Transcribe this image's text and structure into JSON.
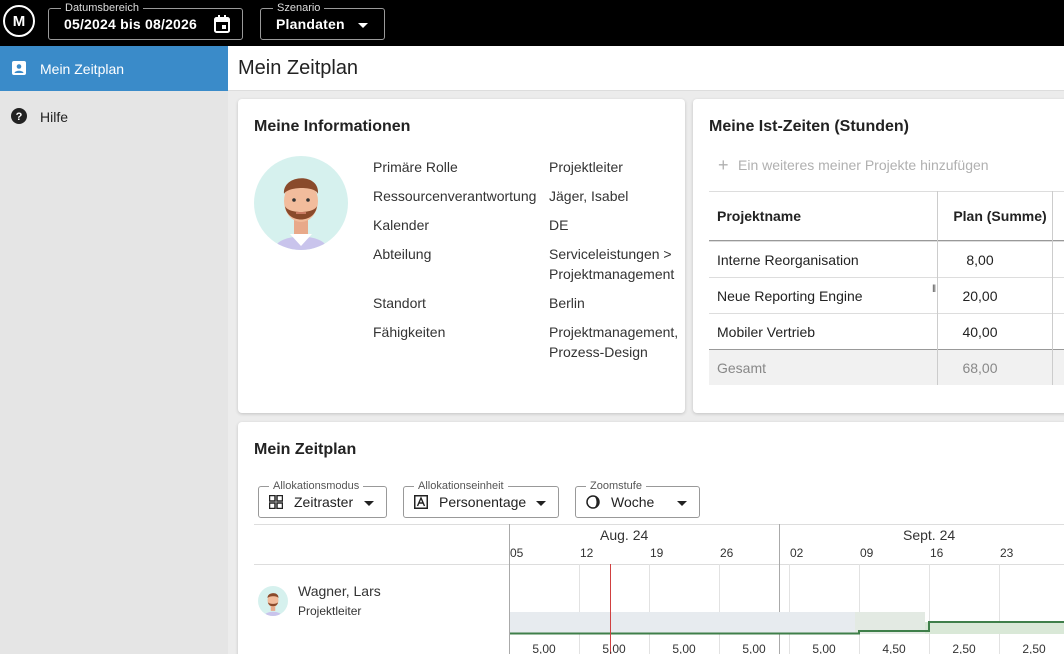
{
  "topbar": {
    "logo": "M",
    "date_range": {
      "label": "Datumsbereich",
      "value": "05/2024 bis 08/2026"
    },
    "scenario": {
      "label": "Szenario",
      "value": "Plandaten"
    }
  },
  "sidebar": {
    "items": [
      {
        "label": "Mein Zeitplan",
        "icon": "badge-icon",
        "active": true
      },
      {
        "label": "Hilfe",
        "icon": "help-icon",
        "active": false
      }
    ]
  },
  "page_title": "Mein Zeitplan",
  "info_card": {
    "title": "Meine Informationen",
    "rows": [
      {
        "label": "Primäre Rolle",
        "value": "Projektleiter"
      },
      {
        "label": "Ressourcenverantwortung",
        "value": "Jäger, Isabel"
      },
      {
        "label": "Kalender",
        "value": "DE"
      },
      {
        "label": "Abteilung",
        "value": "Serviceleistungen > Projektmanagement"
      },
      {
        "label": "Standort",
        "value": "Berlin"
      },
      {
        "label": "Fähigkeiten",
        "value": "Projektmanagement, Prozess-Design"
      }
    ]
  },
  "ist_card": {
    "title": "Meine Ist-Zeiten (Stunden)",
    "add_link": "Ein weiteres meiner Projekte hinzufügen",
    "columns": [
      "Projektname",
      "Plan (Summe)"
    ],
    "rows": [
      {
        "name": "Interne Reorganisation",
        "plan": "8,00"
      },
      {
        "name": "Neue Reporting Engine",
        "plan": "20,00"
      },
      {
        "name": "Mobiler Vertrieb",
        "plan": "40,00"
      }
    ],
    "total": {
      "name": "Gesamt",
      "plan": "68,00"
    }
  },
  "plan_card": {
    "title": "Mein Zeitplan",
    "controls": {
      "mode": {
        "label": "Allokationsmodus",
        "value": "Zeitraster",
        "icon": "grid-icon"
      },
      "unit": {
        "label": "Allokationseinheit",
        "value": "Personentage",
        "icon": "letter-a-icon"
      },
      "zoom": {
        "label": "Zoomstufe",
        "value": "Woche",
        "icon": "moon-icon"
      }
    },
    "months": [
      "Aug. 24",
      "Sept. 24"
    ],
    "weeks": [
      "05",
      "12",
      "19",
      "26",
      "02",
      "09",
      "16",
      "23"
    ],
    "resource": {
      "name": "Wagner, Lars",
      "role": "Projektleiter"
    },
    "values": [
      "5,00",
      "5,00",
      "5,00",
      "5,00",
      "5,00",
      "4,50",
      "2,50",
      "2,50"
    ]
  },
  "colors": {
    "accent": "#3a8bc9",
    "topbar": "#000000",
    "today_line": "#d04040",
    "allocation_line": "#3f7f4a"
  }
}
